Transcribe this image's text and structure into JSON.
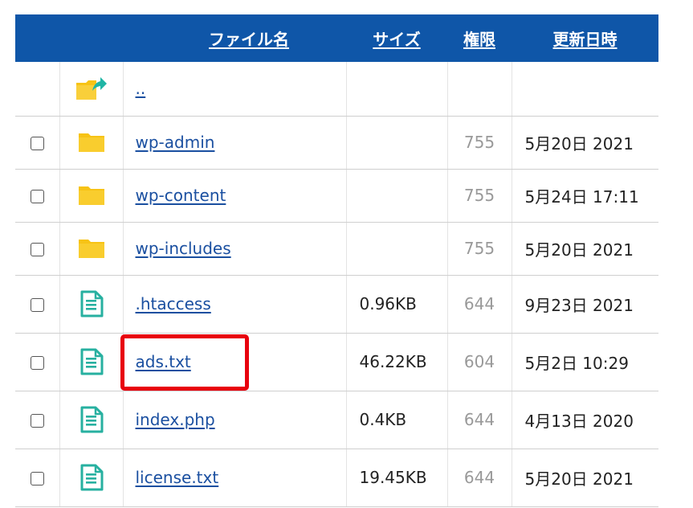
{
  "header": {
    "col_name": "ファイル名",
    "col_size": "サイズ",
    "col_perm": "権限",
    "col_date": "更新日時"
  },
  "parent_row": {
    "name": ".."
  },
  "rows": [
    {
      "name": "wp-admin",
      "type": "folder",
      "size": "",
      "perm": "755",
      "date": "5月20日 2021"
    },
    {
      "name": "wp-content",
      "type": "folder",
      "size": "",
      "perm": "755",
      "date": "5月24日 17:11"
    },
    {
      "name": "wp-includes",
      "type": "folder",
      "size": "",
      "perm": "755",
      "date": "5月20日 2021"
    },
    {
      "name": ".htaccess",
      "type": "file",
      "size": "0.96KB",
      "perm": "644",
      "date": "9月23日 2021"
    },
    {
      "name": "ads.txt",
      "type": "file",
      "size": "46.22KB",
      "perm": "604",
      "date": "5月2日 10:29"
    },
    {
      "name": "index.php",
      "type": "file",
      "size": "0.4KB",
      "perm": "644",
      "date": "4月13日 2020"
    },
    {
      "name": "license.txt",
      "type": "file",
      "size": "19.45KB",
      "perm": "644",
      "date": "5月20日 2021"
    }
  ],
  "colors": {
    "header_bg": "#0f56a8",
    "link": "#1a4fa0",
    "folder": "#f7c315",
    "file_icon": "#27b0a0",
    "highlight": "#e8000d"
  },
  "icons": {
    "parent": "folder-up-icon",
    "folder": "folder-icon",
    "file": "document-icon"
  }
}
